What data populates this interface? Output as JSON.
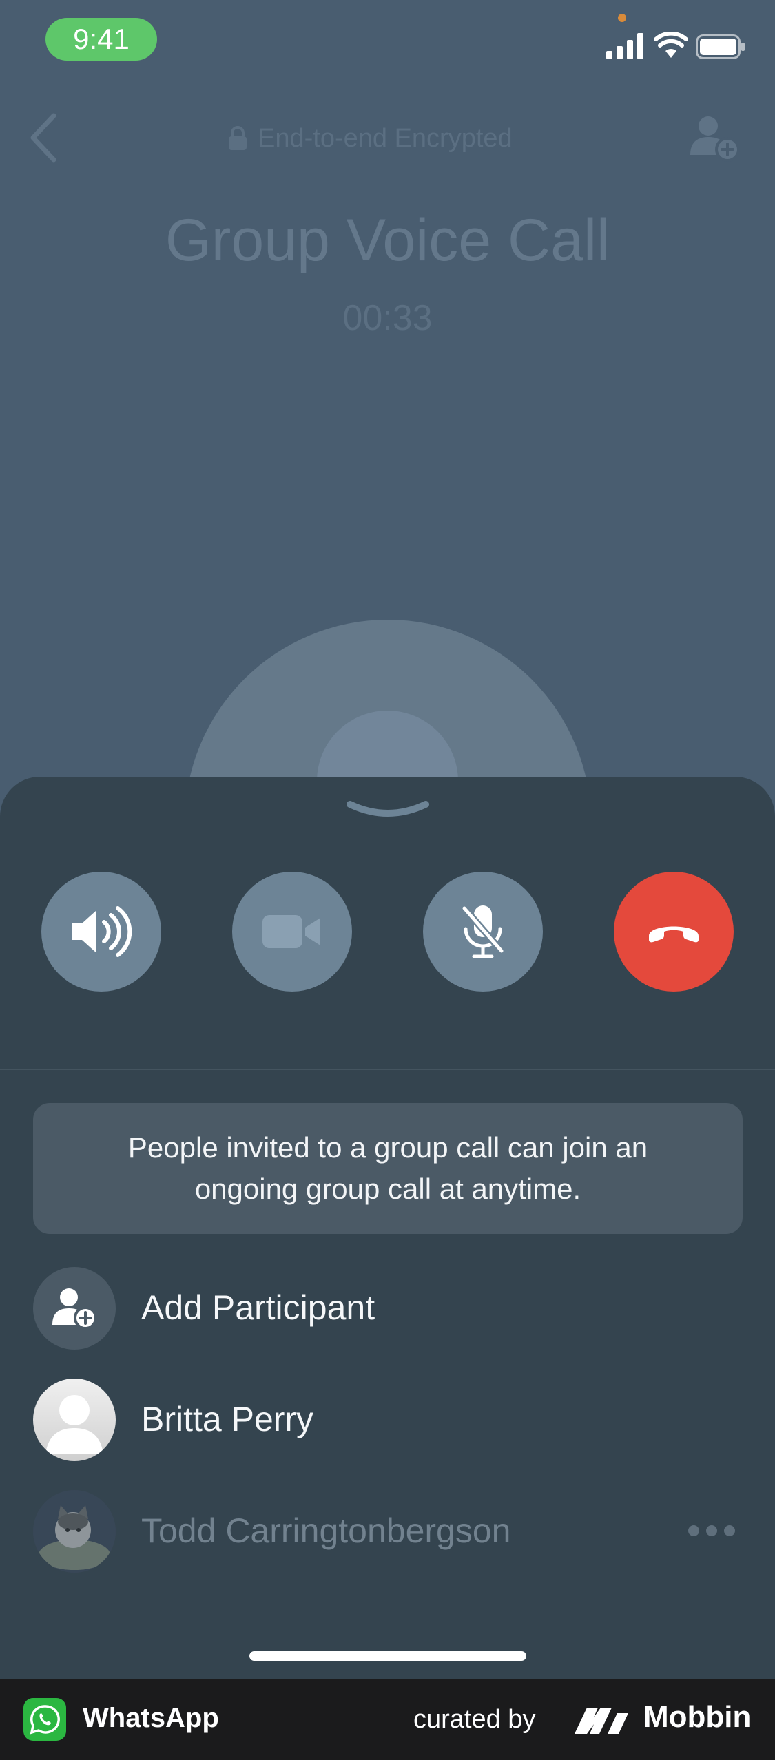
{
  "status_bar": {
    "time": "9:41"
  },
  "header": {
    "encryption_label": "End-to-end Encrypted",
    "title": "Group Voice Call",
    "timer": "00:33"
  },
  "controls": [
    {
      "name": "speaker",
      "icon": "speaker-icon"
    },
    {
      "name": "video",
      "icon": "video-camera-icon"
    },
    {
      "name": "mute",
      "icon": "mic-off-icon"
    },
    {
      "name": "end-call",
      "icon": "phone-hangup-icon",
      "color": "#e4493c"
    }
  ],
  "notice": {
    "text": "People invited to a group call can join an ongoing group call at anytime."
  },
  "participants": {
    "add_label": "Add Participant",
    "list": [
      {
        "name": "Britta Perry",
        "status": "connected"
      },
      {
        "name": "Todd Carringtonbergson",
        "status": "ringing"
      }
    ]
  },
  "footer": {
    "app_name": "WhatsApp",
    "curated_by": "curated by",
    "brand": "Mobbin"
  },
  "colors": {
    "background": "#495d70",
    "sheet": "#34444f",
    "control": "#6d8496",
    "end_call": "#e4493c",
    "accent_whatsapp": "#2bb741"
  }
}
